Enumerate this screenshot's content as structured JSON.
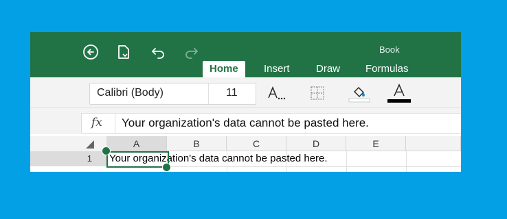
{
  "window": {
    "title": "Book"
  },
  "tabs": [
    {
      "label": "Home",
      "active": true
    },
    {
      "label": "Insert",
      "active": false
    },
    {
      "label": "Draw",
      "active": false
    },
    {
      "label": "Formulas",
      "active": false
    }
  ],
  "ribbon": {
    "font_name": "Calibri (Body)",
    "font_size": "11",
    "font_color": "#000000",
    "fill_color": "#ffffff"
  },
  "formula_bar": {
    "fx_label": "fx",
    "value": "Your organization's data cannot be pasted here."
  },
  "sheet": {
    "columns": [
      "A",
      "B",
      "C",
      "D",
      "E"
    ],
    "rows": [
      "1"
    ],
    "selected_cell": "A1",
    "cell_a1": "Your organization's data cannot be pasted here."
  },
  "colors": {
    "brand": "#217346",
    "background": "#03A0E6"
  }
}
